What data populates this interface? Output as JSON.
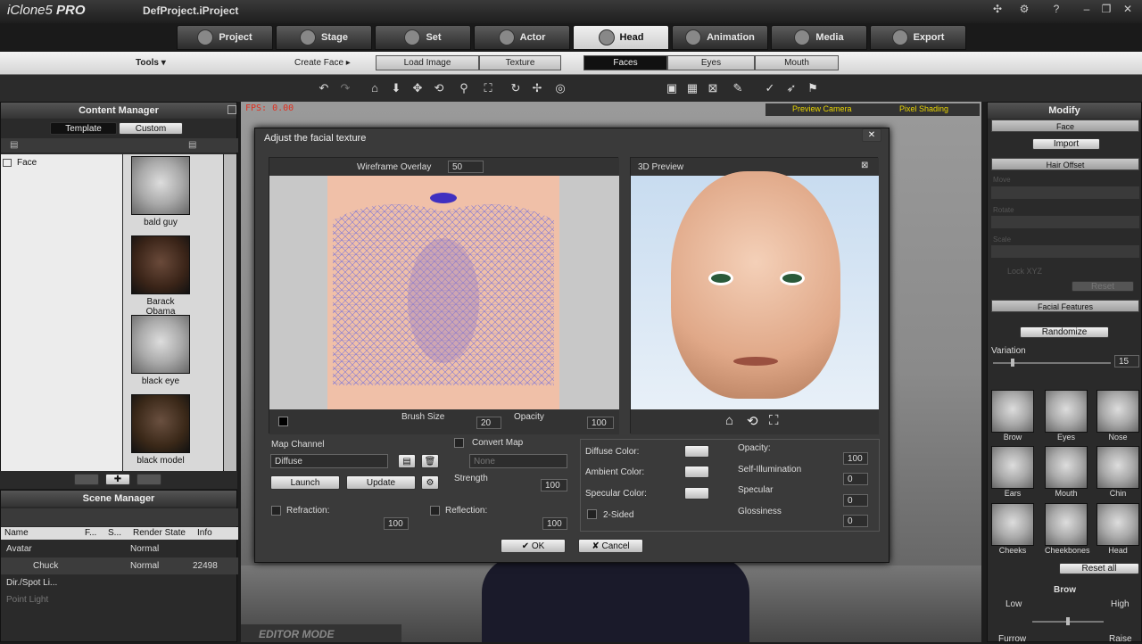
{
  "app": {
    "logo": "iClone5",
    "edition": "PRO",
    "project": "DefProject.iProject"
  },
  "tabs": [
    {
      "label": "Project"
    },
    {
      "label": "Stage"
    },
    {
      "label": "Set"
    },
    {
      "label": "Actor"
    },
    {
      "label": "Head"
    },
    {
      "label": "Animation"
    },
    {
      "label": "Media"
    },
    {
      "label": "Export"
    }
  ],
  "subbar": {
    "tools": "Tools ▾",
    "create_face": "Create Face ▸",
    "load_image": "Load Image",
    "texture": "Texture",
    "faces": "Faces",
    "eyes": "Eyes",
    "mouth": "Mouth"
  },
  "content_manager": {
    "title": "Content Manager",
    "tab_template": "Template",
    "tab_custom": "Custom",
    "tree_item": "Face",
    "items": [
      {
        "label": "bald guy"
      },
      {
        "label": "Barack Obama"
      },
      {
        "label": "black eye"
      },
      {
        "label": "black model"
      }
    ]
  },
  "scene_manager": {
    "title": "Scene Manager",
    "cols": [
      "Name",
      "F...",
      "S...",
      "Render State",
      "Info"
    ],
    "rows": [
      {
        "name": "Avatar",
        "state": "Normal",
        "info": ""
      },
      {
        "name": "Chuck",
        "state": "Normal",
        "info": "22498"
      },
      {
        "name": "Dir./Spot Li...",
        "state": "",
        "info": ""
      },
      {
        "name": "Point Light",
        "state": "",
        "info": ""
      }
    ]
  },
  "viewport": {
    "fps": "FPS: 0.00",
    "camera": "Preview Camera",
    "shading": "Pixel Shading",
    "mode": "EDITOR MODE"
  },
  "dialog": {
    "title": "Adjust the facial texture",
    "wireframe_label": "Wireframe Overlay",
    "wireframe_value": "50",
    "brush_size_label": "Brush Size",
    "brush_size_value": "20",
    "opacity_label": "Opacity",
    "opacity_value": "100",
    "preview_title": "3D Preview",
    "map_channel_label": "Map Channel",
    "map_channel_value": "Diffuse",
    "convert_map_label": "Convert Map",
    "convert_map_value": "None",
    "launch": "Launch",
    "update": "Update",
    "strength_label": "Strength",
    "strength_value": "100",
    "refraction_label": "Refraction:",
    "refraction_value": "100",
    "reflection_label": "Reflection:",
    "reflection_value": "100",
    "diffuse_color": "Diffuse Color:",
    "ambient_color": "Ambient Color:",
    "specular_color": "Specular Color:",
    "two_sided": "2-Sided",
    "mat_opacity_label": "Opacity:",
    "mat_opacity_value": "100",
    "self_illum_label": "Self-Illumination",
    "self_illum_value": "0",
    "specular_label": "Specular",
    "specular_value": "0",
    "glossiness_label": "Glossiness",
    "glossiness_value": "0",
    "ok": "OK",
    "cancel": "Cancel"
  },
  "modify": {
    "title": "Modify",
    "face": "Face",
    "import": "Import",
    "hair_offset": "Hair Offset",
    "move": "Move",
    "rotate": "Rotate",
    "scale": "Scale",
    "lock": "Lock XYZ",
    "reset": "Reset",
    "facial_features": "Facial Features",
    "randomize": "Randomize",
    "variation_label": "Variation",
    "variation_value": "15",
    "features": [
      {
        "label": "Brow"
      },
      {
        "label": "Eyes"
      },
      {
        "label": "Nose"
      },
      {
        "label": "Ears"
      },
      {
        "label": "Mouth"
      },
      {
        "label": "Chin"
      },
      {
        "label": "Cheeks"
      },
      {
        "label": "Cheekbones"
      },
      {
        "label": "Head"
      }
    ],
    "reset_all": "Reset all",
    "brow": "Brow",
    "low": "Low",
    "high": "High",
    "furrow": "Furrow",
    "raise": "Raise"
  },
  "colors": {
    "accent_yellow": "#e8d400",
    "fps_red": "#e03020",
    "bg_dark": "#2a2a2a"
  }
}
